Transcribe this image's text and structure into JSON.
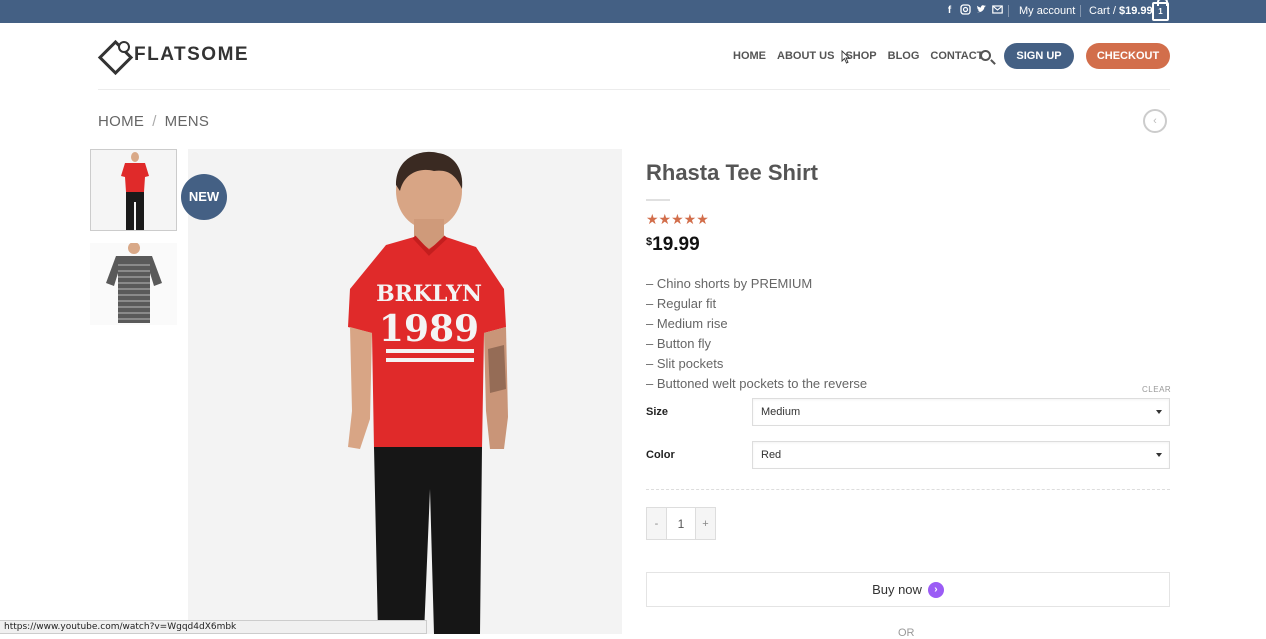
{
  "topbar": {
    "social_icons": [
      "facebook-icon",
      "instagram-icon",
      "twitter-icon",
      "email-icon"
    ],
    "account_label": "My account",
    "cart_label": "Cart /",
    "cart_total": "$19.99",
    "cart_count": "1"
  },
  "header": {
    "logo_text": "FLATSOME",
    "nav": [
      "HOME",
      "ABOUT US",
      "SHOP",
      "BLOG",
      "CONTACT"
    ],
    "signup_label": "SIGN UP",
    "checkout_label": "CHECKOUT"
  },
  "breadcrumb": {
    "home": "HOME",
    "separator": "/",
    "current": "MENS"
  },
  "product": {
    "badge": "NEW",
    "title": "Rhasta Tee Shirt",
    "rating_stars": "★★★★★",
    "price_currency": "$",
    "price_amount": "19.99",
    "description": [
      "– Chino shorts by PREMIUM",
      "– Regular fit",
      "– Medium rise",
      "– Button fly",
      "– Slit pockets",
      "– Buttoned welt pockets to the reverse"
    ],
    "clear_label": "CLEAR",
    "size_label": "Size",
    "size_value": "Medium",
    "color_label": "Color",
    "color_value": "Red",
    "quantity": "1",
    "qty_minus": "-",
    "qty_plus": "+",
    "buy_now_label": "Buy now",
    "or_label": "OR",
    "shirt_text_line1": "BRKLYN",
    "shirt_text_line2": "1989"
  },
  "status_url": "https://www.youtube.com/watch?v=Wgqd4dX6mbk",
  "colors": {
    "primary": "#446084",
    "secondary": "#d26e4b",
    "shirt_red": "#e02a2a",
    "purple_icon": "#9b5cf5"
  }
}
